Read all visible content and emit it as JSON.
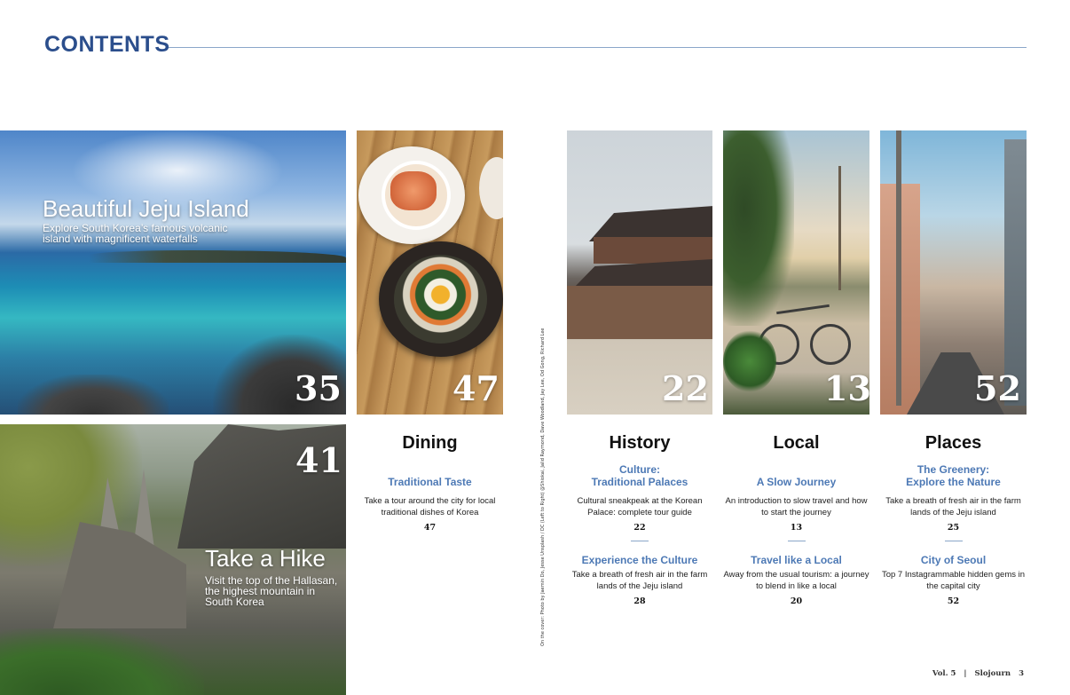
{
  "header": {
    "title": "CONTENTS"
  },
  "features": {
    "jeju": {
      "title": "Beautiful Jeju Island",
      "desc_line1": "Explore South Korea’s famous volcanic",
      "desc_line2": "island with magnificent waterfalls",
      "page": "35"
    },
    "hike": {
      "title": "Take a Hike",
      "desc_line1": "Visit the top of the Hallasan,",
      "desc_line2": "the highest mountain in",
      "desc_line3": "South Korea",
      "page": "41"
    },
    "food": {
      "page": "47"
    },
    "palace": {
      "page": "22"
    },
    "bike": {
      "page": "13"
    },
    "street": {
      "page": "52"
    }
  },
  "sections": {
    "dining": {
      "heading": "Dining",
      "articles": [
        {
          "sub_line1": "Traditional Taste",
          "desc_line1": "Take a tour around the city for local",
          "desc_line2": "traditional dishes of Korea",
          "page": "47"
        }
      ]
    },
    "history": {
      "heading": "History",
      "articles": [
        {
          "sub_line1": "Culture:",
          "sub_line2": "Traditional Palaces",
          "desc_line1": "Cultural sneakpeak at the Korean",
          "desc_line2": "Palace: complete tour guide",
          "page": "22"
        },
        {
          "sub_line1": "Experience the Culture",
          "desc_line1": "Take a breath of fresh air in the farm",
          "desc_line2": "lands of the Jeju island",
          "page": "28"
        }
      ]
    },
    "local": {
      "heading": "Local",
      "articles": [
        {
          "sub_line1": "A Slow Journey",
          "desc_line1": "An introduction to slow travel and how",
          "desc_line2": "to start the journey",
          "page": "13"
        },
        {
          "sub_line1": "Travel like a Local",
          "desc_line1": "Away from the usual tourism: a journey",
          "desc_line2": "to blend in like a local",
          "page": "20"
        }
      ]
    },
    "places": {
      "heading": "Places",
      "articles": [
        {
          "sub_line1": "The Greenery:",
          "sub_line2": "Explore the Nature",
          "desc_line1": "Take a breath of fresh air in the farm",
          "desc_line2": "lands of the Jeju island",
          "page": "25"
        },
        {
          "sub_line1": "City of Seoul",
          "desc_line1": "Top 7 Instagrammable hidden gems in",
          "desc_line2": "the capital city",
          "page": "52"
        }
      ]
    }
  },
  "credits": "On the cover: Photo by Jaemin Do, Jesse Unsplash / DC (Left to Right) @Shiokai, Jalid Raymond, Dave Woodland, Jay Lee, Od Gong, Richard Lee",
  "footer": {
    "vol": "Vol. 5",
    "divider": "|",
    "brand": "Slojourn",
    "page": "3"
  },
  "colors": {
    "accent": "#2b4e8c",
    "subhead": "#4d79b5",
    "rule": "#8aa6c9"
  }
}
